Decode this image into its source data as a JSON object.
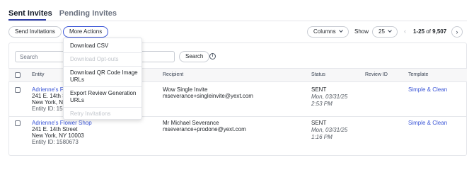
{
  "tabs": [
    {
      "label": "Sent Invites",
      "active": true
    },
    {
      "label": "Pending Invites",
      "active": false
    }
  ],
  "toolbar": {
    "send_invitations": "Send Invitations",
    "more_actions": "More Actions",
    "columns": "Columns",
    "show_label": "Show",
    "page_size": "25",
    "pager_range": "1-25",
    "pager_of": "of",
    "pager_total": "9,507"
  },
  "search": {
    "placeholder": "Search",
    "button": "Search"
  },
  "menu": {
    "items": [
      {
        "label": "Download CSV",
        "disabled": false
      },
      {
        "label": "Download Opt-outs",
        "disabled": true
      },
      {
        "label": "Download QR Code Image",
        "label2": "URLs",
        "disabled": false
      },
      {
        "label": "Export Review Generation",
        "label2": "URLs",
        "disabled": false
      },
      {
        "label": "Retry Invitations",
        "disabled": true
      }
    ]
  },
  "table": {
    "columns": [
      "Entity",
      "Recipient",
      "Status",
      "Review ID",
      "Template"
    ],
    "rows": [
      {
        "entity_name": "Adrienne's Fl",
        "entity_addr1": "241 E. 14th S",
        "entity_addr2": "New York, N",
        "entity_id": "Entity ID: 158",
        "recipient_name": "Wow Single Invite",
        "recipient_email": "mseverance+singleinvite@yext.com",
        "status": "SENT",
        "date": "Mon, 03/31/25",
        "time": "2:53 PM",
        "review_id": "",
        "template": "Simple & Clean"
      },
      {
        "entity_name": "Adrienne's Flower Shop",
        "entity_addr1": "241 E. 14th Street",
        "entity_addr2": "New York, NY 10003",
        "entity_id": "Entity ID: 1580673",
        "recipient_name": "Mr Michael Severance",
        "recipient_email": "mseverance+prodone@yext.com",
        "status": "SENT",
        "date": "Mon, 03/31/25",
        "time": "1:16 PM",
        "review_id": "",
        "template": "Simple & Clean"
      }
    ]
  },
  "icons": {
    "info": "info-icon",
    "chevron_down": "chevron-down-icon",
    "chevron_left": "chevron-left-icon",
    "chevron_right": "chevron-right-icon"
  },
  "colors": {
    "accent": "#3a55d6",
    "tab_underline": "#2f3ea8",
    "disabled": "#c2c6cc"
  }
}
